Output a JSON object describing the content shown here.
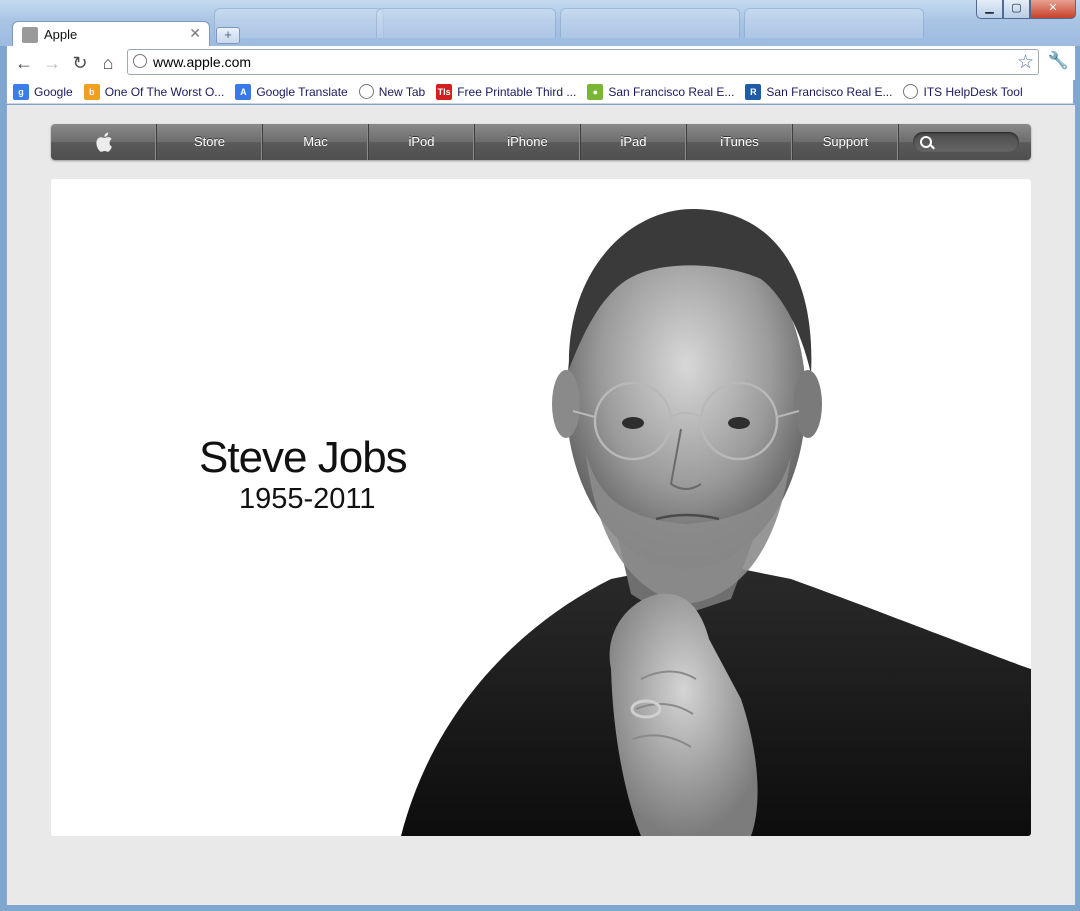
{
  "browser": {
    "active_tab": {
      "title": "Apple"
    },
    "url": "www.apple.com",
    "bookmarks": [
      {
        "label": "Google",
        "icon": "google-icon",
        "color": "#3a7ee8"
      },
      {
        "label": "One Of The Worst O...",
        "icon": "bing-icon",
        "color": "#f0a020"
      },
      {
        "label": "Google Translate",
        "icon": "translate-icon",
        "color": "#3b78e7"
      },
      {
        "label": "New Tab",
        "icon": "globe-icon",
        "color": "#888888"
      },
      {
        "label": "Free Printable Third ...",
        "icon": "tls-icon",
        "color": "#d22020"
      },
      {
        "label": "San Francisco Real E...",
        "icon": "map-pin-icon",
        "color": "#7ab634"
      },
      {
        "label": "San Francisco Real E...",
        "icon": "realtor-icon",
        "color": "#1f5ca8"
      },
      {
        "label": "ITS HelpDesk Tool",
        "icon": "globe-icon",
        "color": "#888888"
      }
    ]
  },
  "site_nav": {
    "items": [
      "Store",
      "Mac",
      "iPod",
      "iPhone",
      "iPad",
      "iTunes",
      "Support"
    ]
  },
  "hero": {
    "name": "Steve Jobs",
    "years": "1955-2011"
  }
}
